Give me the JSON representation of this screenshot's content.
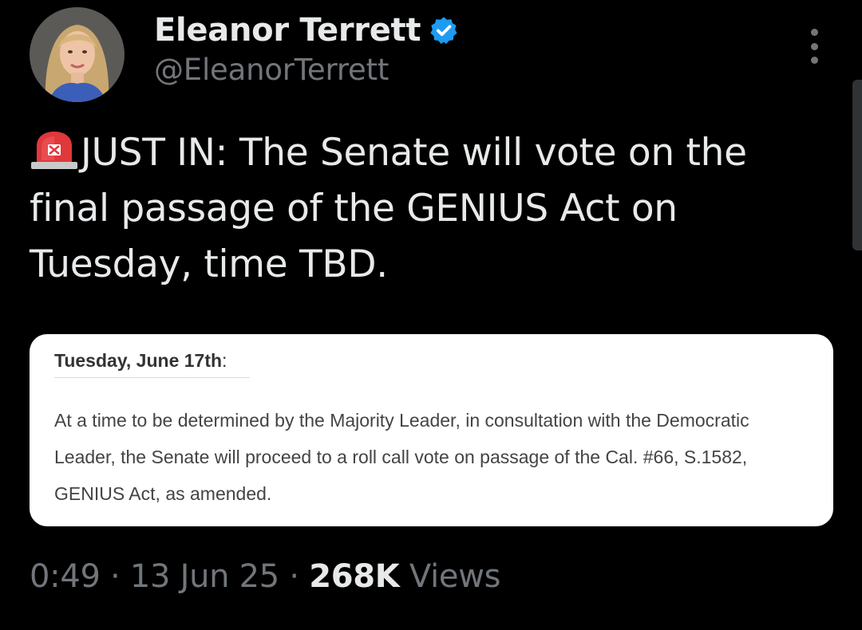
{
  "author": {
    "display_name": "Eleanor Terrett",
    "handle": "@EleanorTerrett",
    "verified": true
  },
  "icons": {
    "avatar": "profile-photo",
    "verified": "verified-badge-icon",
    "more": "more-options-icon",
    "siren": "police-light-emoji"
  },
  "tweet": {
    "text": "JUST IN: The Senate will vote on the final passage of the GENIUS Act on Tuesday, time TBD."
  },
  "attachment": {
    "heading": "Tuesday, June 17th",
    "heading_suffix": ":",
    "body": "At a time to be determined by the Majority Leader, in consultation with the Democratic Leader, the Senate will proceed to a roll call vote on passage of the Cal. #66, S.1582, GENIUS Act, as amended."
  },
  "meta": {
    "time": "0:49",
    "separator": "·",
    "date": "13 Jun 25",
    "views_count": "268K",
    "views_label": "Views"
  },
  "colors": {
    "background": "#000000",
    "primary_text": "#e7e9ea",
    "secondary_text": "#71767b",
    "verified_blue": "#1d9bf0",
    "siren_red": "#e0383b"
  }
}
